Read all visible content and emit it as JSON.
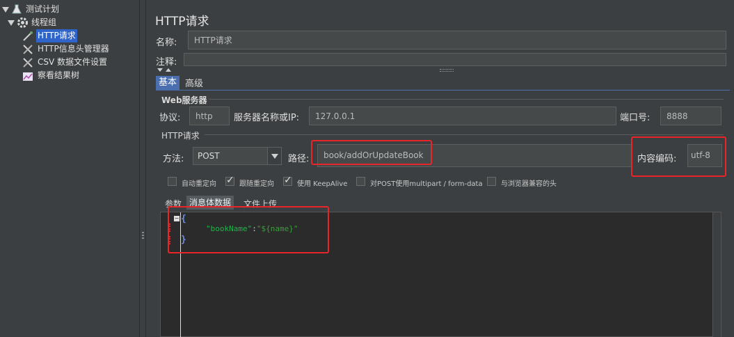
{
  "tree": {
    "items": [
      {
        "label": "测试计划",
        "icon": "flask-icon"
      },
      {
        "label": "线程组",
        "icon": "gear-icon"
      },
      {
        "label": "HTTP请求",
        "icon": "pipette-icon"
      },
      {
        "label": "HTTP信息头管理器",
        "icon": "wrench-icon"
      },
      {
        "label": "CSV 数据文件设置",
        "icon": "wrench-icon"
      },
      {
        "label": "察看结果树",
        "icon": "chart-icon"
      }
    ]
  },
  "panel": {
    "title": "HTTP请求",
    "name_label": "名称:",
    "name_value": "HTTP请求",
    "comment_label": "注释:",
    "tabs": [
      "基本",
      "高级"
    ],
    "web_server_group": "Web服务器",
    "protocol_label": "协议:",
    "protocol_value": "http",
    "server_label": "服务器名称或IP:",
    "server_value": "127.0.0.1",
    "port_label": "端口号:",
    "port_value": "8888",
    "http_request_group": "HTTP请求",
    "method_label": "方法:",
    "method_value": "POST",
    "path_label": "路径:",
    "path_value": "book/addOrUpdateBook",
    "encoding_label": "内容编码:",
    "encoding_value": "utf-8",
    "checkboxes": [
      {
        "label": "自动重定向",
        "checked": false
      },
      {
        "label": "跟随重定向",
        "checked": true
      },
      {
        "label": "使用 KeepAlive",
        "checked": true
      },
      {
        "label": "对POST使用multipart / form-data",
        "checked": false
      },
      {
        "label": "与浏览器兼容的头",
        "checked": false
      }
    ],
    "sub_tabs": [
      "参数",
      "消息体数据",
      "文件上传"
    ],
    "body": {
      "open_brace": "{",
      "key": "\"bookName\"",
      "colon": ":",
      "value": "\"${name}\"",
      "close_brace": "}"
    }
  },
  "colors": {
    "background": "#3c3f41",
    "selection": "#2f65ca",
    "highlight_box": "#e8262a",
    "json_key": "#22b14c",
    "json_value": "#22b14c"
  }
}
